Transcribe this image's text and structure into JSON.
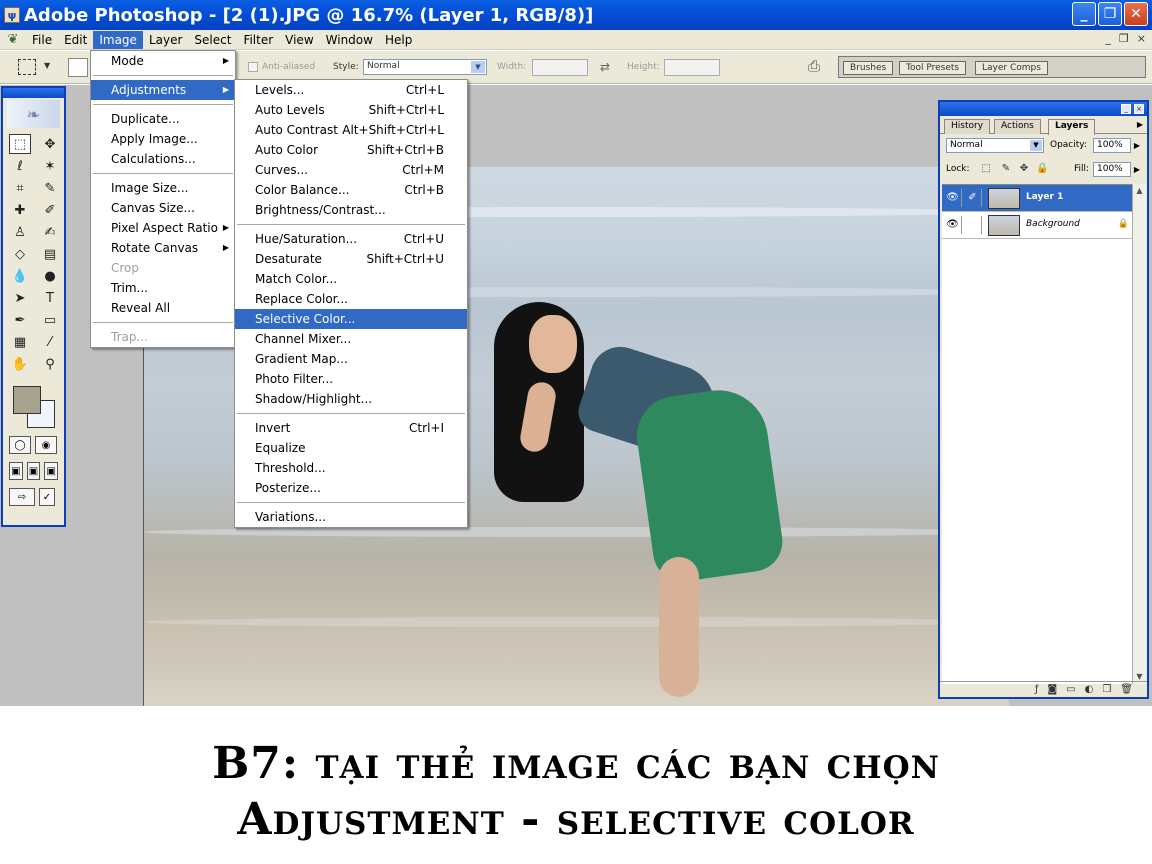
{
  "window": {
    "title": "Adobe Photoshop - [2 (1).JPG @ 16.7% (Layer 1, RGB/8)]",
    "buttons": [
      "_",
      "❐",
      "✕"
    ]
  },
  "menubar": {
    "items": [
      "File",
      "Edit",
      "Image",
      "Layer",
      "Select",
      "Filter",
      "View",
      "Window",
      "Help"
    ],
    "active": "Image",
    "doc_buttons": [
      "_",
      "❐",
      "×"
    ]
  },
  "options": {
    "anti_aliased": "Anti-aliased",
    "style_label": "Style:",
    "style_value": "Normal",
    "width_label": "Width:",
    "height_label": "Height:"
  },
  "palette_well": {
    "tabs": [
      "Brushes",
      "Tool Presets",
      "Layer Comps"
    ]
  },
  "image_menu": {
    "items": [
      {
        "label": "Mode",
        "submenu": true
      },
      {
        "sep": true
      },
      {
        "label": "Adjustments",
        "submenu": true,
        "highlighted": true
      },
      {
        "sep": true
      },
      {
        "label": "Duplicate..."
      },
      {
        "label": "Apply Image..."
      },
      {
        "label": "Calculations..."
      },
      {
        "sep": true
      },
      {
        "label": "Image Size..."
      },
      {
        "label": "Canvas Size..."
      },
      {
        "label": "Pixel Aspect Ratio",
        "submenu": true
      },
      {
        "label": "Rotate Canvas",
        "submenu": true
      },
      {
        "label": "Crop",
        "disabled": true
      },
      {
        "label": "Trim..."
      },
      {
        "label": "Reveal All"
      },
      {
        "sep": true
      },
      {
        "label": "Trap...",
        "disabled": true
      }
    ]
  },
  "adjustments_menu": {
    "items": [
      {
        "label": "Levels...",
        "shortcut": "Ctrl+L"
      },
      {
        "label": "Auto Levels",
        "shortcut": "Shift+Ctrl+L"
      },
      {
        "label": "Auto Contrast",
        "shortcut": "Alt+Shift+Ctrl+L"
      },
      {
        "label": "Auto Color",
        "shortcut": "Shift+Ctrl+B"
      },
      {
        "label": "Curves...",
        "shortcut": "Ctrl+M"
      },
      {
        "label": "Color Balance...",
        "shortcut": "Ctrl+B"
      },
      {
        "label": "Brightness/Contrast..."
      },
      {
        "sep": true
      },
      {
        "label": "Hue/Saturation...",
        "shortcut": "Ctrl+U"
      },
      {
        "label": "Desaturate",
        "shortcut": "Shift+Ctrl+U"
      },
      {
        "label": "Match Color..."
      },
      {
        "label": "Replace Color..."
      },
      {
        "label": "Selective Color...",
        "highlighted": true
      },
      {
        "label": "Channel Mixer..."
      },
      {
        "label": "Gradient Map..."
      },
      {
        "label": "Photo Filter..."
      },
      {
        "label": "Shadow/Highlight..."
      },
      {
        "sep": true
      },
      {
        "label": "Invert",
        "shortcut": "Ctrl+I"
      },
      {
        "label": "Equalize"
      },
      {
        "label": "Threshold..."
      },
      {
        "label": "Posterize..."
      },
      {
        "sep": true
      },
      {
        "label": "Variations..."
      }
    ]
  },
  "layers_panel": {
    "tabs": [
      "History",
      "Actions",
      "Layers"
    ],
    "active_tab": "Layers",
    "blend_mode": "Normal",
    "opacity_label": "Opacity:",
    "opacity": "100%",
    "lock_label": "Lock:",
    "fill_label": "Fill:",
    "fill": "100%",
    "layers": [
      {
        "name": "Layer 1",
        "selected": true
      },
      {
        "name": "Background",
        "locked": true
      }
    ]
  },
  "caption": {
    "line1": "B7: tại thẻ image các bạn chọn",
    "line2": "Adjustment - selective color"
  },
  "colors": {
    "title_bar": "#0450d8",
    "menu_highlight": "#316ac5",
    "foreground_swatch": "#a8a28c",
    "background_swatch": "#f0f4fb"
  }
}
